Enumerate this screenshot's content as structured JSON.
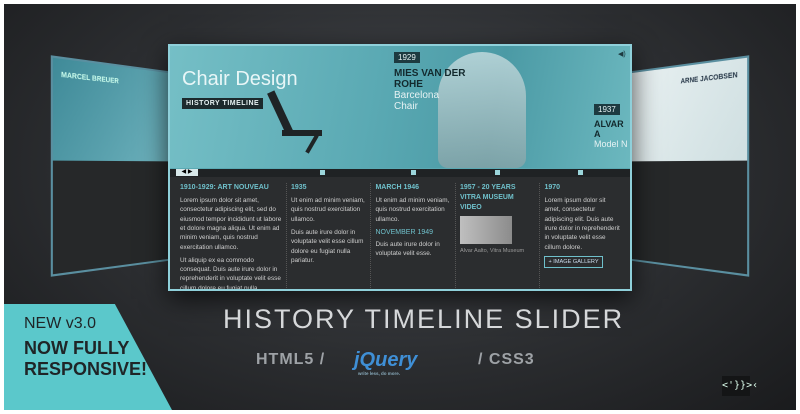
{
  "hero": {
    "title": "Chair Design",
    "subtitle": "HISTORY TIMELINE",
    "year_1": "1929",
    "person_1_name_line1": "MIES VAN DER",
    "person_1_name_line2": "ROHE",
    "person_1_sub_line1": "Barcelona",
    "person_1_sub_line2": "Chair",
    "year_2": "1937",
    "person_2_name": "ALVAR A",
    "person_2_sub": "Model N"
  },
  "timeline": [
    {
      "heading": "1910-1929: ART NOUVEAU",
      "text_1": "Lorem ipsum dolor sit amet, consectetur adipiscing elit, sed do eiusmod tempor incididunt ut labore et dolore magna aliqua. Ut enim ad minim veniam, quis nostrud exercitation ullamco.",
      "text_2": "Ut aliquip ex ea commodo consequat. Duis aute irure dolor in reprehenderit in voluptate velit esse cillum dolore eu fugiat nulla pariatur."
    },
    {
      "heading": "1935",
      "text_1": "Ut enim ad minim veniam, quis nostrud exercitation ullamco.",
      "text_2": "Duis aute irure dolor in voluptate velit esse cillum dolore eu fugiat nulla pariatur."
    },
    {
      "heading": "MARCH 1946",
      "text_1": "Ut enim ad minim veniam, quis nostrud exercitation ullamco.",
      "subheading": "NOVEMBER 1949",
      "text_2": "Duis aute irure dolor in voluptate velit esse."
    },
    {
      "heading": "1957 - 20 YEARS VITRA MUSEUM VIDEO",
      "caption": "Alvar Aalto, Vitra Museum"
    },
    {
      "heading": "1970",
      "text_1": "Lorem ipsum dolor sit amet, consectetur adipiscing elit. Duis aute irure dolor in reprehenderit in voluptate velit esse cillum dolore.",
      "button": "+ IMAGE GALLERY"
    }
  ],
  "side_left_title": "MARCEL BREUER",
  "side_right_title": "ARNE JACOBSEN",
  "ribbon": {
    "line1": "NEW v3.0",
    "line2": "NOW FULLY",
    "line3": "RESPONSIVE!"
  },
  "product_title": "HISTORY TIMELINE SLIDER",
  "tech": {
    "html5": "HTML5  /",
    "jquery": "jQuery",
    "jquery_tag": "write less, do more.",
    "css3": "/  CSS3"
  },
  "brand_logo": "<'}}>‹",
  "colors": {
    "accent": "#5bc8cb",
    "heading": "#6fc0cb",
    "background": "#2c2e31"
  },
  "icons": [
    "play-icon",
    "volume-icon"
  ]
}
